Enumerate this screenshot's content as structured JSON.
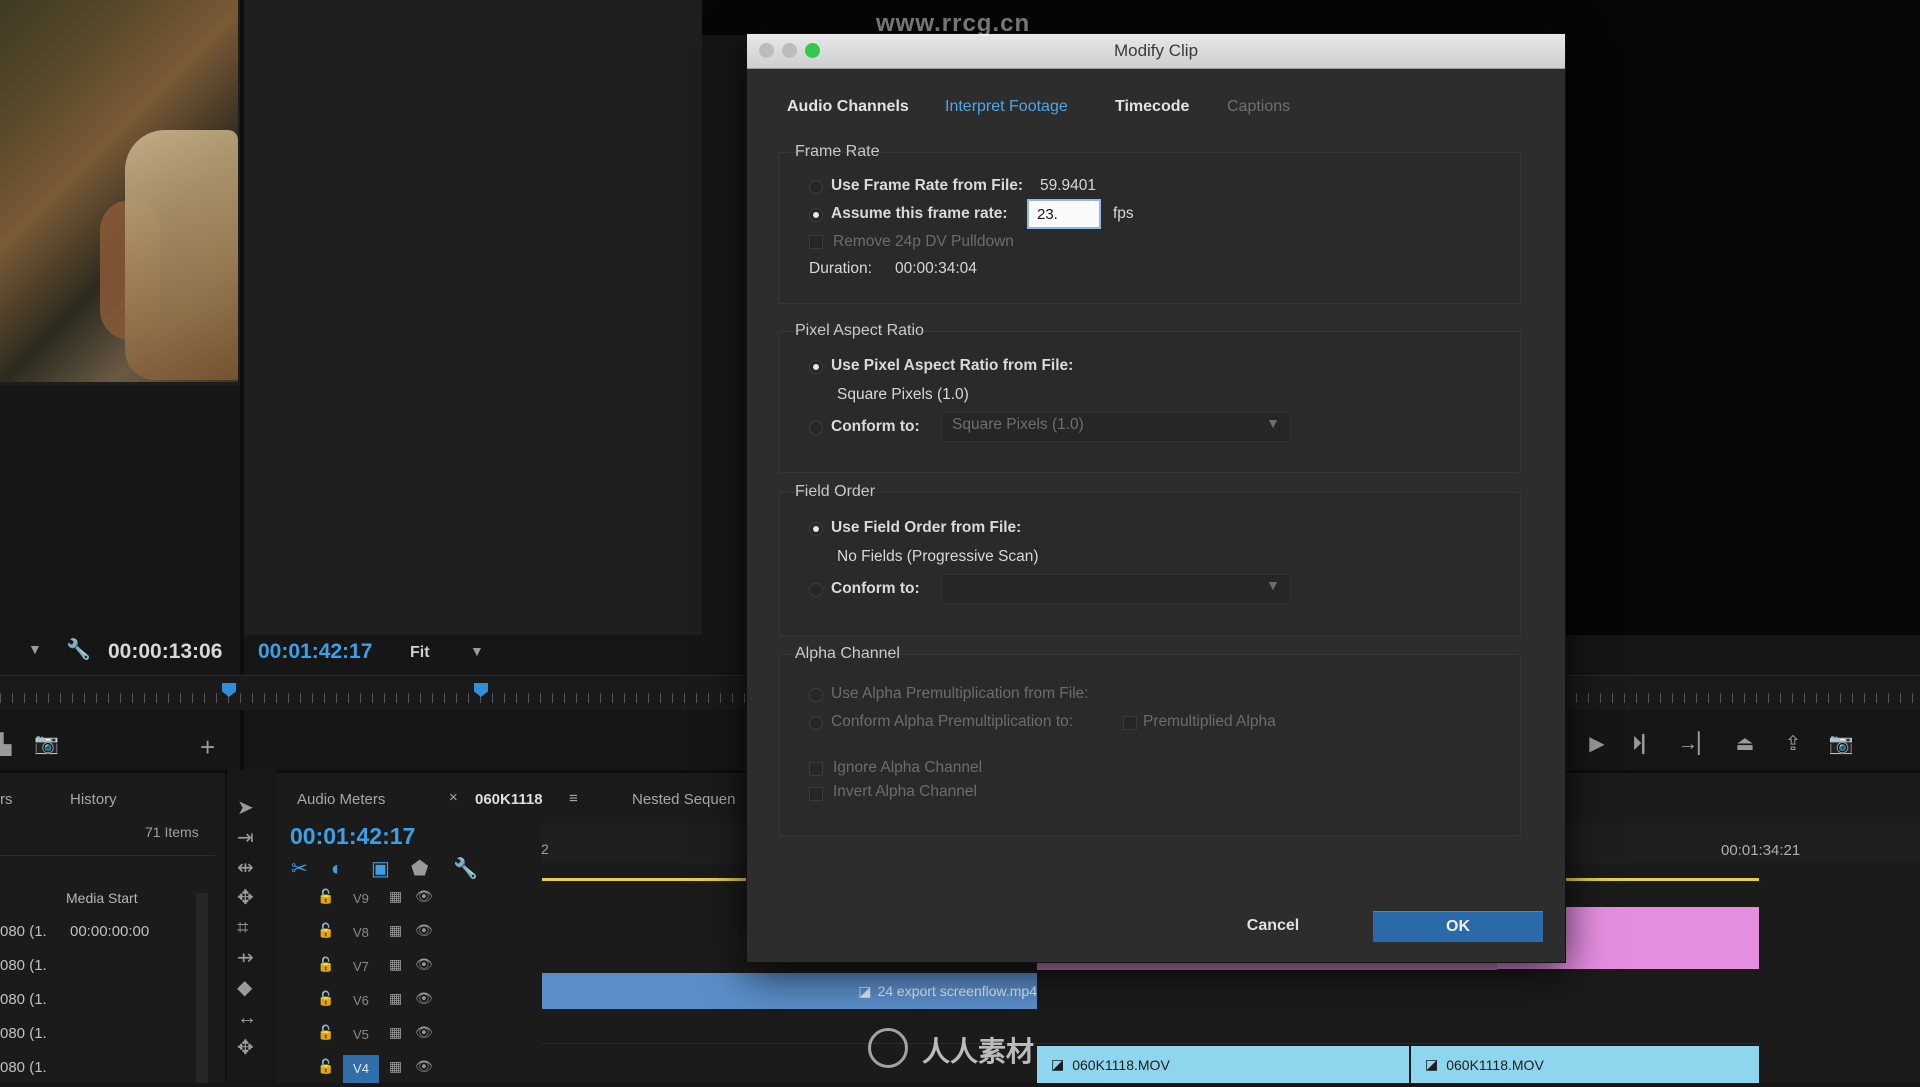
{
  "watermark": {
    "top_url": "www.rrcg.cn",
    "bottom_brand": "人人素材"
  },
  "source_monitor": {
    "timecode": "00:00:13:06"
  },
  "program_monitor": {
    "timecode": "00:01:42:17",
    "zoom": "Fit"
  },
  "project_panel": {
    "tabs": [
      "rs",
      "History"
    ],
    "item_count": "71 Items",
    "column_header": "Media Start",
    "rows": [
      {
        "name": "080 (1.",
        "start": "00:00:00:00"
      },
      {
        "name": "080 (1.",
        "start": ""
      },
      {
        "name": "080 (1.",
        "start": ""
      },
      {
        "name": "080 (1.",
        "start": ""
      },
      {
        "name": "080 (1.",
        "start": ""
      }
    ]
  },
  "timeline": {
    "tabs": {
      "audio_meters": "Audio Meters",
      "close": "×",
      "sequence": "060K1118",
      "menu": "≡",
      "nested": "Nested Sequen"
    },
    "timecode": "00:01:42:17",
    "ruler_start": "2",
    "ruler_end": "00:01:34:21",
    "tracks": [
      "V9",
      "V8",
      "V7",
      "V6",
      "V5",
      "V4"
    ],
    "clips": {
      "export_clip": "24 export screenflow.mp4",
      "mov_clip_a": "060K1118.MOV",
      "mov_clip_b": "060K1118.MOV"
    }
  },
  "dialog": {
    "title": "Modify Clip",
    "tabs": {
      "audio_channels": "Audio Channels",
      "interpret_footage": "Interpret Footage",
      "timecode": "Timecode",
      "captions": "Captions"
    },
    "frame_rate": {
      "title": "Frame Rate",
      "use_from_file_label": "Use Frame Rate from File:",
      "file_rate": "59.9401",
      "assume_label": "Assume this frame rate:",
      "assume_value": "23.",
      "fps_unit": "fps",
      "pulldown_label": "Remove 24p DV Pulldown",
      "duration_label": "Duration:",
      "duration_value": "00:00:34:04"
    },
    "pixel_aspect": {
      "title": "Pixel Aspect Ratio",
      "use_from_file_label": "Use Pixel Aspect Ratio from File:",
      "file_value": "Square Pixels (1.0)",
      "conform_label": "Conform to:",
      "conform_value": "Square Pixels (1.0)"
    },
    "field_order": {
      "title": "Field Order",
      "use_from_file_label": "Use Field Order from File:",
      "file_value": "No Fields (Progressive Scan)",
      "conform_label": "Conform to:",
      "conform_value": ""
    },
    "alpha": {
      "title": "Alpha Channel",
      "use_from_file_label": "Use Alpha Premultiplication from File:",
      "conform_label": "Conform Alpha Premultiplication to:",
      "conform_value": "Premultiplied Alpha",
      "ignore_label": "Ignore Alpha Channel",
      "invert_label": "Invert Alpha Channel"
    },
    "buttons": {
      "cancel": "Cancel",
      "ok": "OK"
    }
  },
  "colors": {
    "accent_blue": "#3aa0e8",
    "ok_button": "#2a6aa8",
    "clip_pink": "#e58ee0",
    "clip_cyan": "#8ed6ee",
    "clip_blue": "#5b8ec9"
  }
}
